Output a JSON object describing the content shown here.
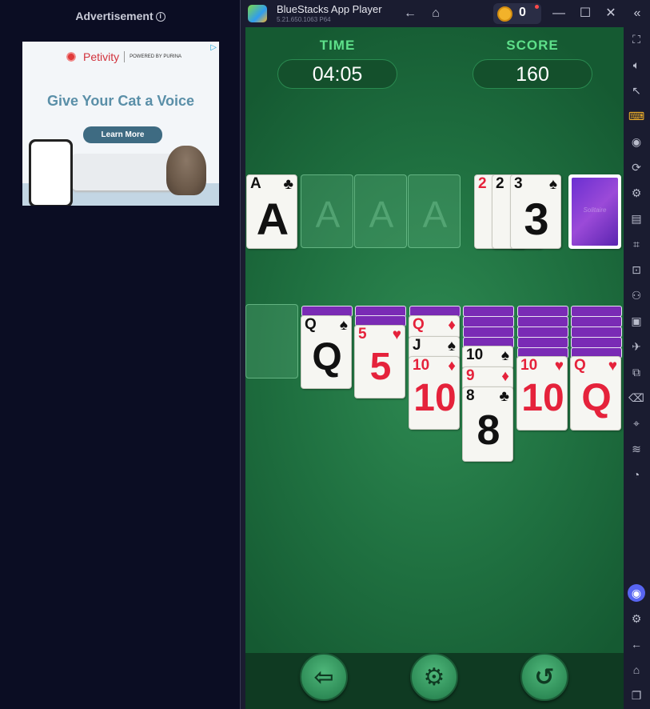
{
  "ad": {
    "header": "Advertisement",
    "brand": "Petivity",
    "powered_by": "POWERED BY PURINA",
    "headline": "Give Your Cat a Voice",
    "cta": "Learn More"
  },
  "window": {
    "title": "BlueStacks App Player",
    "version": "5.21.650.1063  P64",
    "coins": "0"
  },
  "game": {
    "time_label": "TIME",
    "time_value": "04:05",
    "score_label": "SCORE",
    "score_value": "160",
    "foundation_placeholder": "A",
    "stock_label": "Solitaire"
  },
  "cards": {
    "foundation_ace": {
      "rank": "A",
      "suit": "♣"
    },
    "waste_1": {
      "rank": "2",
      "suit": ""
    },
    "waste_2": {
      "rank": "2",
      "suit": ""
    },
    "waste_top": {
      "rank": "3",
      "suit": "♠"
    },
    "t2_q": {
      "rank": "Q",
      "suit": "♠"
    },
    "t3_5": {
      "rank": "5",
      "suit": "♥"
    },
    "t4_q": {
      "rank": "Q",
      "suit": "♦"
    },
    "t4_j": {
      "rank": "J",
      "suit": "♠"
    },
    "t4_10": {
      "rank": "10",
      "suit": "♦"
    },
    "t5_10": {
      "rank": "10",
      "suit": "♠"
    },
    "t5_9": {
      "rank": "9",
      "suit": "♦"
    },
    "t5_8": {
      "rank": "8",
      "suit": "♣"
    },
    "t6_10": {
      "rank": "10",
      "suit": "♥"
    },
    "t7_q": {
      "rank": "Q",
      "suit": "♥"
    }
  },
  "colors": {
    "felt": "#1f7040",
    "card_back": "#7a2bb5",
    "red_suit": "#e5223b",
    "hud_label": "#5ee08a"
  }
}
